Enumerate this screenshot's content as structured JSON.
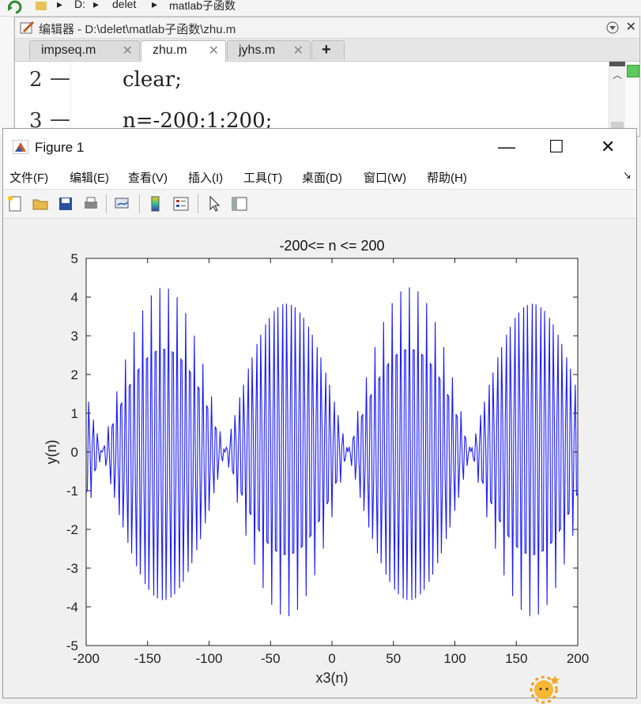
{
  "address_bar": {
    "segments": [
      "D:",
      "delet",
      "matlab子函数"
    ]
  },
  "editor": {
    "title": "编辑器 - D:\\delet\\matlab子函数\\zhu.m",
    "tabs": [
      {
        "label": "impseq.m",
        "active": false
      },
      {
        "label": "zhu.m",
        "active": true
      },
      {
        "label": "jyhs.m",
        "active": false
      }
    ],
    "add_tab": "+",
    "close_glyph": "✕",
    "lines": [
      {
        "number": "2",
        "code": "clear;"
      },
      {
        "number": "3",
        "code": "n=-200:1:200;"
      }
    ]
  },
  "figure": {
    "title": "Figure 1",
    "window_buttons": {
      "minimize": "—",
      "maximize": "☐",
      "close": "✕"
    },
    "menu": [
      "文件(F)",
      "编辑(E)",
      "查看(V)",
      "插入(I)",
      "工具(T)",
      "桌面(D)",
      "窗口(W)",
      "帮助(H)"
    ],
    "menu_arrow": "↘"
  },
  "chart_data": {
    "type": "line",
    "title": "-200<= n <= 200",
    "xlabel": "x3(n)",
    "ylabel": "y(n)",
    "xlim": [
      -200,
      200
    ],
    "ylim": [
      -5,
      5
    ],
    "xticks": [
      -200,
      -150,
      -100,
      -50,
      0,
      50,
      100,
      150,
      200
    ],
    "yticks": [
      5,
      4,
      3,
      2,
      1,
      0,
      -1,
      -2,
      -3,
      -4,
      -5
    ],
    "x_range": {
      "start": -200,
      "stop": 200,
      "step": 1
    },
    "envelope_amplitude": 4.25,
    "envelope_period": 100,
    "envelope_peaks_x": [
      -137,
      -37,
      63,
      163
    ],
    "carrier_period": 3.5,
    "series": [
      {
        "color": "#1a1aff"
      }
    ]
  },
  "colors": {
    "line": "#1a1aff",
    "axes_bg": "#ffffff",
    "figure_bg": "#f0f0f0"
  }
}
